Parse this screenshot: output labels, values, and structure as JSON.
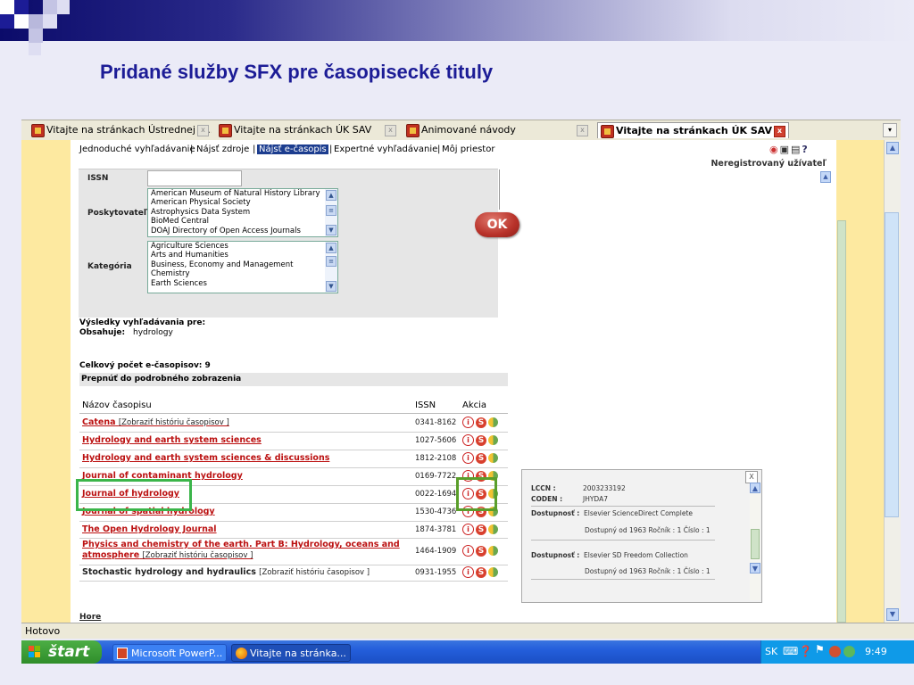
{
  "slide": {
    "title": "Pridané služby SFX pre časopisecké tituly"
  },
  "browser": {
    "tabs": [
      {
        "label": "Vitajte na stránkach Ústrednej k..."
      },
      {
        "label": "Vitajte na stránkach ÚK SAV"
      },
      {
        "label": "Animované návody"
      },
      {
        "label": "Vitajte na stránkach ÚK SAV",
        "active": true
      }
    ],
    "status": "Hotovo"
  },
  "page": {
    "nav": [
      "Jednoduché vyhľadávanie",
      "Nájsť zdroje",
      "Nájsť e-časopis",
      "Expertné vyhľadávanie",
      "Môj priestor"
    ],
    "user": "Neregistrovaný užívateľ",
    "form": {
      "issn_label": "ISSN",
      "provider_label": "Poskytovateľ",
      "providers": [
        "American Museum of Natural History Library",
        "American Physical Society",
        "Astrophysics Data System",
        "BioMed Central",
        "DOAJ Directory of Open Access Journals"
      ],
      "category_label": "Kategória",
      "categories": [
        "Agriculture Sciences",
        "Arts and Humanities",
        "Business, Economy and Management",
        "Chemistry",
        "Earth Sciences"
      ],
      "ok": "OK"
    },
    "results_for": "Výsledky vyhľadávania pre:",
    "contains_label": "Obsahuje:",
    "contains_value": "hydrology",
    "total": "Celkový počet e-časopisov: 9",
    "detail_toggle": "Prepnúť do podrobného zobrazenia",
    "col_title": "Názov časopisu",
    "col_issn": "ISSN",
    "col_action": "Akcia",
    "journals": [
      {
        "title": "Catena",
        "history": "[Zobraziť históriu časopisov ]",
        "issn": "0341-8162"
      },
      {
        "title": "Hydrology and earth system sciences",
        "issn": "1027-5606"
      },
      {
        "title": "Hydrology and earth system sciences & discussions",
        "issn": "1812-2108"
      },
      {
        "title": "Journal of contaminant hydrology",
        "issn": "0169-7722"
      },
      {
        "title": "Journal of hydrology",
        "issn": "0022-1694"
      },
      {
        "title": "Journal of spatial hydrology",
        "issn": "1530-4736"
      },
      {
        "title": "The Open Hydrology Journal",
        "issn": "1874-3781"
      },
      {
        "title": "Physics and chemistry of the earth. Part B: Hydrology, oceans and",
        "title2": "atmosphere",
        "history": "[Zobraziť históriu časopisov ]",
        "issn": "1464-1909"
      },
      {
        "title": "Stochastic hydrology and hydraulics",
        "history": "[Zobraziť históriu časopisov ]",
        "issn": "0931-1955"
      }
    ],
    "more": "Hore",
    "popup": {
      "lccn_label": "LCCN :",
      "lccn": "2003233192",
      "coden_label": "CODEN :",
      "coden": "JHYDA7",
      "avail_label": "Dostupnosť :",
      "avail1": "Elsevier ScienceDirect Complete",
      "avail1_detail": "Dostupný od 1963 Ročník : 1 Číslo : 1",
      "avail2": "Elsevier SD Freedom Collection",
      "avail2_detail": "Dostupný od 1963 Ročník : 1 Číslo : 1",
      "close": "X"
    }
  },
  "taskbar": {
    "start": "štart",
    "items": [
      "Microsoft PowerP...",
      "Vitajte na stránka..."
    ],
    "lang": "SK",
    "time": "9:49"
  }
}
